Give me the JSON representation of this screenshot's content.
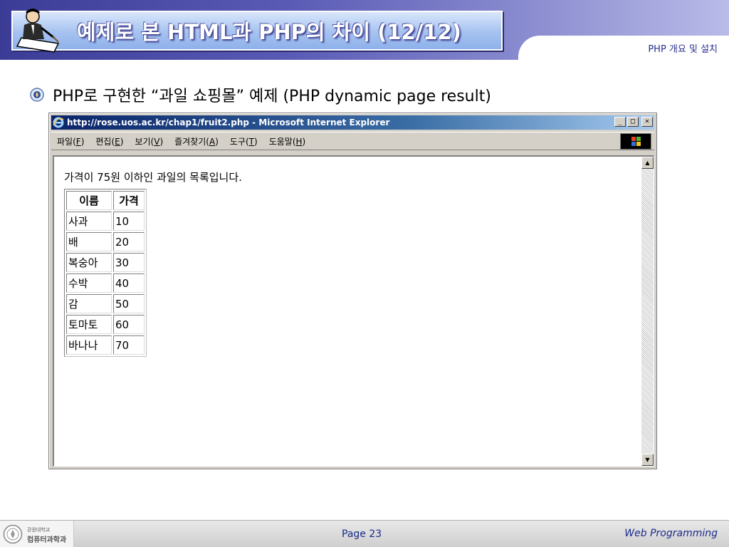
{
  "slide": {
    "title": "예제로 본 HTML과 PHP의 차이 (12/12)",
    "subtitle": "PHP 개요 및 설치",
    "bullet": "PHP로 구현한 “과일 쇼핑몰” 예제 (PHP dynamic page result)"
  },
  "browser": {
    "title": "http://rose.uos.ac.kr/chap1/fruit2.php - Microsoft Internet Explorer",
    "window_buttons": {
      "minimize": "_",
      "maximize": "□",
      "close": "×"
    },
    "menu": [
      {
        "label": "파일",
        "key": "F"
      },
      {
        "label": "편집",
        "key": "E"
      },
      {
        "label": "보기",
        "key": "V"
      },
      {
        "label": "즐겨찾기",
        "key": "A"
      },
      {
        "label": "도구",
        "key": "T"
      },
      {
        "label": "도움말",
        "key": "H"
      }
    ],
    "page": {
      "heading": "가격이 75원 이하인 과일의 목록입니다.",
      "table": {
        "headers": [
          "이름",
          "가격"
        ],
        "rows": [
          {
            "name": "사과",
            "price": "10"
          },
          {
            "name": "배",
            "price": "20"
          },
          {
            "name": "복숭아",
            "price": "30"
          },
          {
            "name": "수박",
            "price": "40"
          },
          {
            "name": "감",
            "price": "50"
          },
          {
            "name": "토마토",
            "price": "60"
          },
          {
            "name": "바나나",
            "price": "70"
          }
        ]
      }
    },
    "scroll": {
      "up": "▲",
      "down": "▼"
    }
  },
  "footer": {
    "university": "강원대학교",
    "department": "컴퓨터과학과",
    "page": "Page 23",
    "course": "Web Programming"
  },
  "colors": {
    "header_dark": "#3b3c95",
    "title_text": "#ffffff",
    "ie_titlebar": "#0a246a",
    "footer_text": "#1a2a8a"
  },
  "icons": {
    "title_icon": "man-writing-icon",
    "bullet_icon": "university-emblem-icon",
    "ie_logo": "ie-logo-icon",
    "throbber": "windows-logo-icon"
  }
}
